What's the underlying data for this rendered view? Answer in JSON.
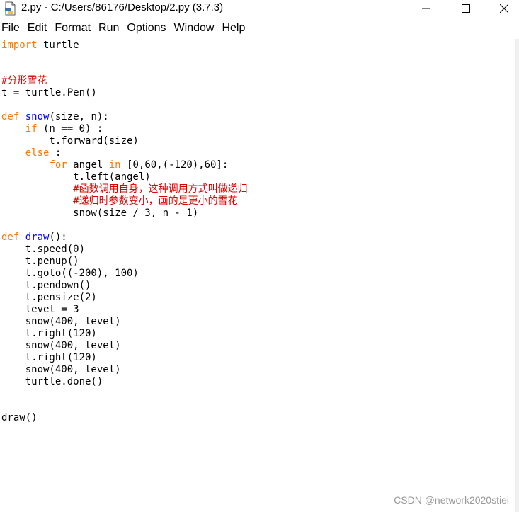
{
  "window": {
    "title": "2.py - C:/Users/86176/Desktop/2.py (3.7.3)",
    "icon": "python-file-icon",
    "controls": [
      "minimize-icon",
      "maximize-icon",
      "close-icon"
    ]
  },
  "menu": {
    "file": "File",
    "edit": "Edit",
    "format": "Format",
    "run": "Run",
    "options": "Options",
    "window": "Window",
    "help": "Help"
  },
  "code": {
    "l1": {
      "kw": "import",
      "rest": " turtle"
    },
    "l2": {
      "comment": "#分形雪花"
    },
    "l3": {
      "text": "t = turtle.Pen()"
    },
    "l4": {
      "kw": "def",
      "sp": " ",
      "fn": "snow",
      "rest": "(size, n):"
    },
    "l5": {
      "indent": "    ",
      "kw": "if",
      "rest": " (n == 0) :"
    },
    "l6": {
      "text": "        t.forward(size)"
    },
    "l7": {
      "indent": "    ",
      "kw": "else",
      "rest": " :"
    },
    "l8": {
      "indent": "        ",
      "kw": "for",
      "mid": " angel ",
      "kw2": "in",
      "rest": " [0,60,(-120),60]:"
    },
    "l9": {
      "text": "            t.left(angel)"
    },
    "l10": {
      "indent": "            ",
      "comment": "#函数调用自身，这种调用方式叫做递归"
    },
    "l11": {
      "indent": "            ",
      "comment": "#递归时参数变小，画的是更小的雪花"
    },
    "l12": {
      "text": "            snow(size / 3, n - 1)"
    },
    "l13": {
      "kw": "def",
      "sp": " ",
      "fn": "draw",
      "rest": "():"
    },
    "l14": {
      "text": "    t.speed(0)"
    },
    "l15": {
      "text": "    t.penup()"
    },
    "l16": {
      "text": "    t.goto((-200), 100)"
    },
    "l17": {
      "text": "    t.pendown()"
    },
    "l18": {
      "text": "    t.pensize(2)"
    },
    "l19": {
      "text": "    level = 3"
    },
    "l20": {
      "text": "    snow(400, level)"
    },
    "l21": {
      "text": "    t.right(120)"
    },
    "l22": {
      "text": "    snow(400, level)"
    },
    "l23": {
      "text": "    t.right(120)"
    },
    "l24": {
      "text": "    snow(400, level)"
    },
    "l25": {
      "text": "    turtle.done()"
    },
    "l26": {
      "text": "draw()"
    }
  },
  "watermark": "CSDN @network2020stiei",
  "colors": {
    "keyword": "#ff7700",
    "definition": "#0000ff",
    "comment": "#dd0000",
    "text": "#000000"
  }
}
